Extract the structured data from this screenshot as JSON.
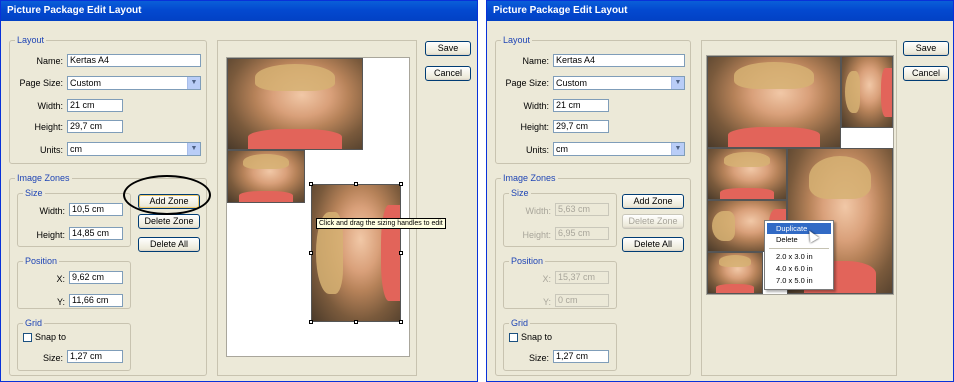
{
  "dialog": {
    "title": "Picture Package Edit Layout",
    "layout_group": "Layout",
    "name_label": "Name:",
    "name_value": "Kertas A4",
    "page_size_label": "Page Size:",
    "page_size_value": "Custom",
    "width_label": "Width:",
    "width_value": "21 cm",
    "height_label": "Height:",
    "height_value": "29,7 cm",
    "units_label": "Units:",
    "units_value": "cm",
    "image_zones_group": "Image Zones",
    "size_group": "Size",
    "zone_width_label": "Width:",
    "zone_height_label": "Height:",
    "position_group": "Position",
    "x_label": "X:",
    "y_label": "Y:",
    "grid_group": "Grid",
    "snap_label": "Snap to",
    "grid_size_label": "Size:",
    "grid_size_value": "1,27 cm",
    "add_zone": "Add Zone",
    "delete_zone": "Delete Zone",
    "delete_all": "Delete All",
    "save": "Save",
    "cancel": "Cancel"
  },
  "left": {
    "zone_width": "10,5 cm",
    "zone_height": "14,85 cm",
    "x": "9,62 cm",
    "y": "11,66 cm",
    "tooltip": "Click and drag the sizing handles to edit"
  },
  "right": {
    "zone_width": "5,63 cm",
    "zone_height": "6,95 cm",
    "x": "15,37 cm",
    "y": "0 cm",
    "context_menu": [
      "Duplicate",
      "Delete",
      "2.0 x 3.0 in",
      "4.0 x 6.0 in",
      "7.0 x 5.0 in"
    ]
  },
  "colors": {
    "title_bar": "#0349d0",
    "dialog_bg": "#ece9d8",
    "group_label": "#1f45b5",
    "menu_highlight": "#316ac5"
  }
}
